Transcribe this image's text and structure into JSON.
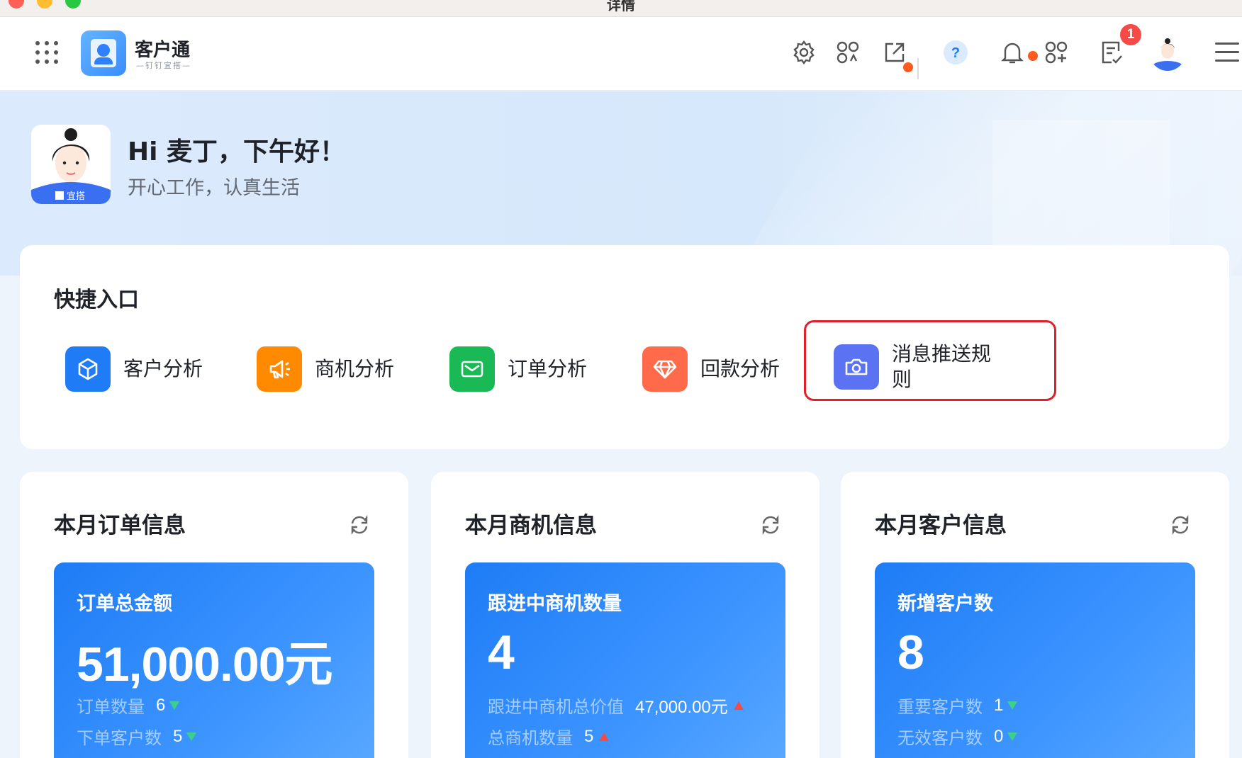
{
  "window": {
    "title": "详情"
  },
  "header": {
    "brand_name": "客户通",
    "brand_sub": "—钉钉宜搭—",
    "notification_badge": "1"
  },
  "hero": {
    "greeting": "Hi 麦丁，下午好！",
    "subtitle": "开心工作，认真生活",
    "avatar_tag": "宜搭"
  },
  "quick_entry": {
    "title": "快捷入口",
    "items": [
      {
        "label": "客户分析",
        "color": "#1f7cf6",
        "icon": "cube-icon"
      },
      {
        "label": "商机分析",
        "color": "#ff8a00",
        "icon": "megaphone-icon"
      },
      {
        "label": "订单分析",
        "color": "#19b955",
        "icon": "mail-icon"
      },
      {
        "label": "回款分析",
        "color": "#ff6b4a",
        "icon": "diamond-icon"
      },
      {
        "label": "消息推送规则",
        "color": "#5b72f2",
        "icon": "camera-icon"
      }
    ]
  },
  "cards": [
    {
      "title": "本月订单信息",
      "main_label": "订单总金额",
      "main_value": "51,000.00元",
      "rows": [
        {
          "label": "订单数量",
          "value": "6",
          "trend": "down"
        },
        {
          "label": "下单客户数",
          "value": "5",
          "trend": "down"
        }
      ]
    },
    {
      "title": "本月商机信息",
      "main_label": "跟进中商机数量",
      "main_value": "4",
      "rows": [
        {
          "label": "跟进中商机总价值",
          "value": "47,000.00元",
          "trend": "up"
        },
        {
          "label": "总商机数量",
          "value": "5",
          "trend": "up"
        }
      ]
    },
    {
      "title": "本月客户信息",
      "main_label": "新增客户数",
      "main_value": "8",
      "rows": [
        {
          "label": "重要客户数",
          "value": "1",
          "trend": "down"
        },
        {
          "label": "无效客户数",
          "value": "0",
          "trend": "down"
        }
      ]
    }
  ],
  "colors": {
    "accent": "#1f7cf6",
    "highlight_border": "#e0202a",
    "trend_up": "#f54a45",
    "trend_down": "#3dd08a"
  }
}
